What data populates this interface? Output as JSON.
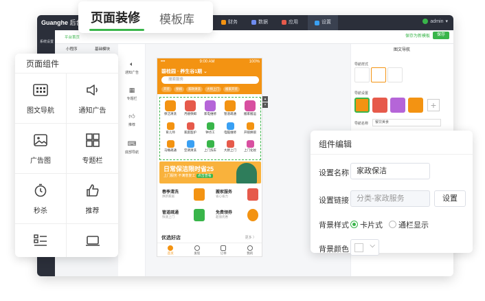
{
  "app": {
    "logo": "Guanghe",
    "logo_suffix": "后台",
    "nav": [
      {
        "label": "财务",
        "color": "#f39312"
      },
      {
        "label": "数据",
        "color": "#6e8cf0"
      },
      {
        "label": "应用",
        "color": "#e65a4b"
      },
      {
        "label": "设置",
        "color": "#3aa0f3"
      }
    ],
    "admin": "admin",
    "rail_label": "系统设置",
    "subtab_active": "平台首页",
    "subtab_2": "小程序",
    "subtab_3": "基础模块",
    "save_template": "保存为新模板",
    "save": "保存",
    "side_items": [
      "通知广告",
      "专题栏",
      "推荐",
      "底部导航"
    ]
  },
  "tabs": {
    "active": "页面装修",
    "inactive": "模板库"
  },
  "components": {
    "title": "页面组件",
    "items": [
      {
        "label": "图文导航",
        "icon": "grid-icon"
      },
      {
        "label": "通知广告",
        "icon": "speaker-icon"
      },
      {
        "label": "广告图",
        "icon": "image-icon"
      },
      {
        "label": "专题栏",
        "icon": "layout-icon"
      },
      {
        "label": "秒杀",
        "icon": "stopwatch-icon"
      },
      {
        "label": "推荐",
        "icon": "thumb-icon"
      },
      {
        "label": "",
        "icon": "list-icon"
      },
      {
        "label": "",
        "icon": "keyboard-icon"
      }
    ]
  },
  "phone": {
    "status_left": "••• ",
    "time": "9:00 AM",
    "battery": "100%",
    "location": "碧桂园 · 养生谷1期 ⌄",
    "search_placeholder": "搜索服务",
    "tags": [
      "开荒",
      "保姆",
      "家政清洗",
      "大师上门",
      "搬家开荒"
    ],
    "grid_main": [
      {
        "label": "保洁清洗",
        "color": "#f39312"
      },
      {
        "label": "月嫂保姆",
        "color": "#e65a4b"
      },
      {
        "label": "家电维修",
        "color": "#b565d8"
      },
      {
        "label": "管道疏通",
        "color": "#f39312"
      },
      {
        "label": "搬家搬运",
        "color": "#d84fa0"
      }
    ],
    "grid_small": [
      {
        "label": "育儿师",
        "color": "#f39312"
      },
      {
        "label": "家庭医护",
        "color": "#e65a4b"
      },
      {
        "label": "钟点工",
        "color": "#39b54a"
      },
      {
        "label": "电脑维修",
        "color": "#3aa0f3"
      },
      {
        "label": "开锁换锁",
        "color": "#f39312"
      },
      {
        "label": "马桶疏通",
        "color": "#f39312"
      },
      {
        "label": "空调清洗",
        "color": "#3aa0f3"
      },
      {
        "label": "上门洗车",
        "color": "#39b54a"
      },
      {
        "label": "大厨上门",
        "color": "#e65a4b"
      },
      {
        "label": "上门化妆",
        "color": "#d84fa0"
      }
    ],
    "banner_title": "日常保洁限时省25",
    "banner_sub": "上门服务  不满意复工  ",
    "banner_tag": "点击查看",
    "cards": [
      {
        "title": "春季清洗",
        "sub": "焕新家居",
        "color": "#f39312"
      },
      {
        "title": "搬家服务",
        "sub": "省心省力",
        "color": "#e65a4b"
      },
      {
        "title": "管道疏通",
        "sub": "快速上门",
        "color": "#39b54a"
      },
      {
        "title": "免费领券",
        "sub": "超值优惠",
        "color": "#f39312"
      }
    ],
    "shop_title": "优选好店",
    "more": "更多 〉",
    "tabbar": [
      "首页",
      "发现",
      "订单",
      "我的"
    ]
  },
  "right_panel": {
    "title": "图文导航",
    "nav_style_label": "导航样式",
    "nav_setting_label": "导航设置",
    "name_label": "导航名称",
    "name_value": "餐饮美食"
  },
  "editor": {
    "title": "组件编辑",
    "name_label": "设置名称",
    "name_value": "家政保洁",
    "link_label": "设置链接",
    "link_value": "分类-家政服务",
    "link_button": "设置",
    "bg_style_label": "背景样式",
    "bg_option_1": "卡片式",
    "bg_option_2": "通栏显示",
    "bg_color_label": "背景颜色",
    "bg_color_value": "#ffffff"
  }
}
